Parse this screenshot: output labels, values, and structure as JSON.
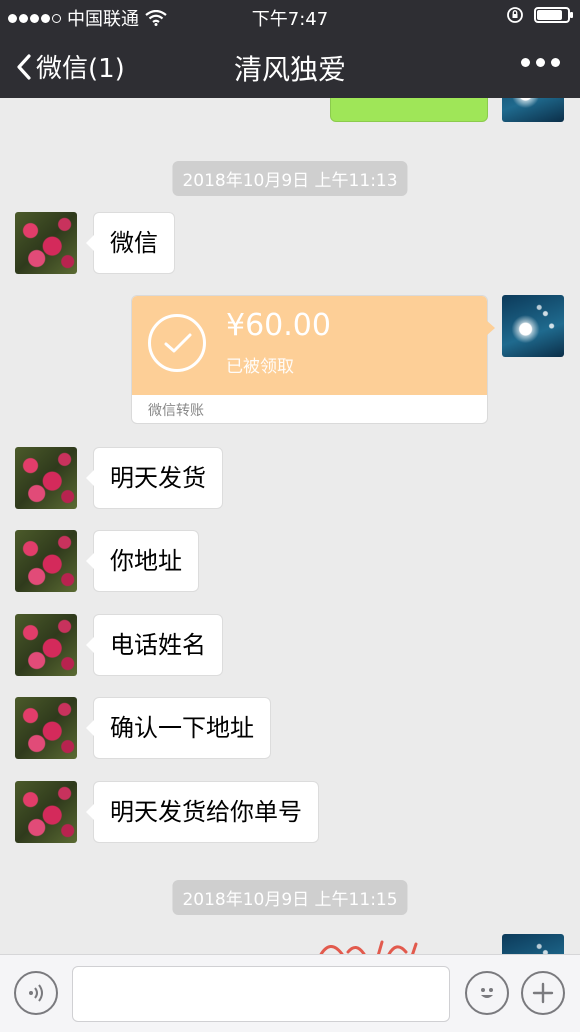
{
  "status_bar": {
    "carrier": "中国联通",
    "time": "下午7:47",
    "signal_dots": 5,
    "battery_level": 0.9
  },
  "nav": {
    "back_label": "微信(1)",
    "title": "清风独爱"
  },
  "chat": {
    "timestamps": [
      "2018年10月9日 上午11:13",
      "2018年10月9日 上午11:15"
    ],
    "messages": [
      {
        "side": "left",
        "text": "微信"
      },
      {
        "side": "left",
        "text": "明天发货"
      },
      {
        "side": "left",
        "text": "你地址"
      },
      {
        "side": "left",
        "text": "电话姓名"
      },
      {
        "side": "left",
        "text": "确认一下地址"
      },
      {
        "side": "left",
        "text": "明天发货给你单号"
      }
    ],
    "transfer": {
      "amount": "¥60.00",
      "status": "已被领取",
      "label": "微信转账"
    }
  },
  "colors": {
    "nav_bg": "#2e2e33",
    "chat_bg": "#ebebeb",
    "transfer_bg": "#fdcf97",
    "sent_bubble": "#9fe658"
  }
}
